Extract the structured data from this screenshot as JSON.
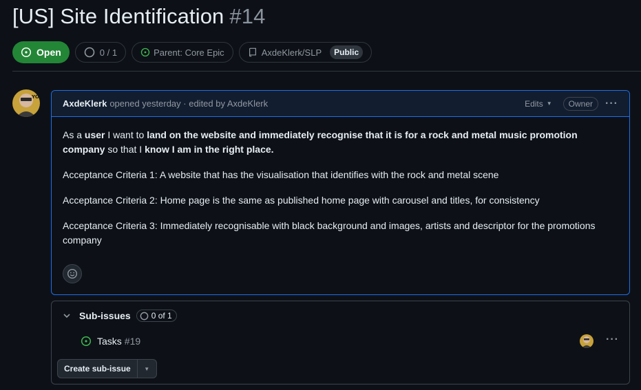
{
  "issue": {
    "title": "[US] Site Identification",
    "number": "#14",
    "state": "Open",
    "subissue_progress": "0 / 1",
    "parent": "Parent: Core Epic",
    "repo": "AxdeKlerk/SLP",
    "visibility": "Public"
  },
  "comment": {
    "author": "AxdeKlerk",
    "meta": "opened yesterday · edited by AxdeKlerk",
    "edits_label": "Edits",
    "role_badge": "Owner",
    "body": {
      "p1": {
        "t1": "As a ",
        "b1": "user",
        "t2": " I want to ",
        "b2": "land on the website and immediately recognise that it is for a rock and metal music promotion company",
        "t3": " so that I ",
        "b3": "know I am in the right place."
      },
      "criteria": [
        "Acceptance Criteria 1: A website that has the visualisation that identifies with the rock and metal scene",
        "Acceptance Criteria 2: Home page is the same as published home page with carousel and titles, for consistency",
        "Acceptance Criteria 3: Immediately recognisable with black background and images, artists and descriptor for the promotions company"
      ]
    }
  },
  "sub_issues": {
    "title": "Sub-issues",
    "count": "0 of 1",
    "items": [
      {
        "title": "Tasks",
        "number": "#19"
      }
    ],
    "create_label": "Create sub-issue"
  },
  "colors": {
    "background": "#0d1117",
    "open_green": "#238636",
    "accent_blue": "#1f6feb",
    "border": "#30363d",
    "muted_text": "#9198a1"
  },
  "icons": [
    "issue-open-icon",
    "progress-circle-icon",
    "repo-icon",
    "smiley-icon",
    "chevron-down-icon",
    "kebab-icon"
  ]
}
